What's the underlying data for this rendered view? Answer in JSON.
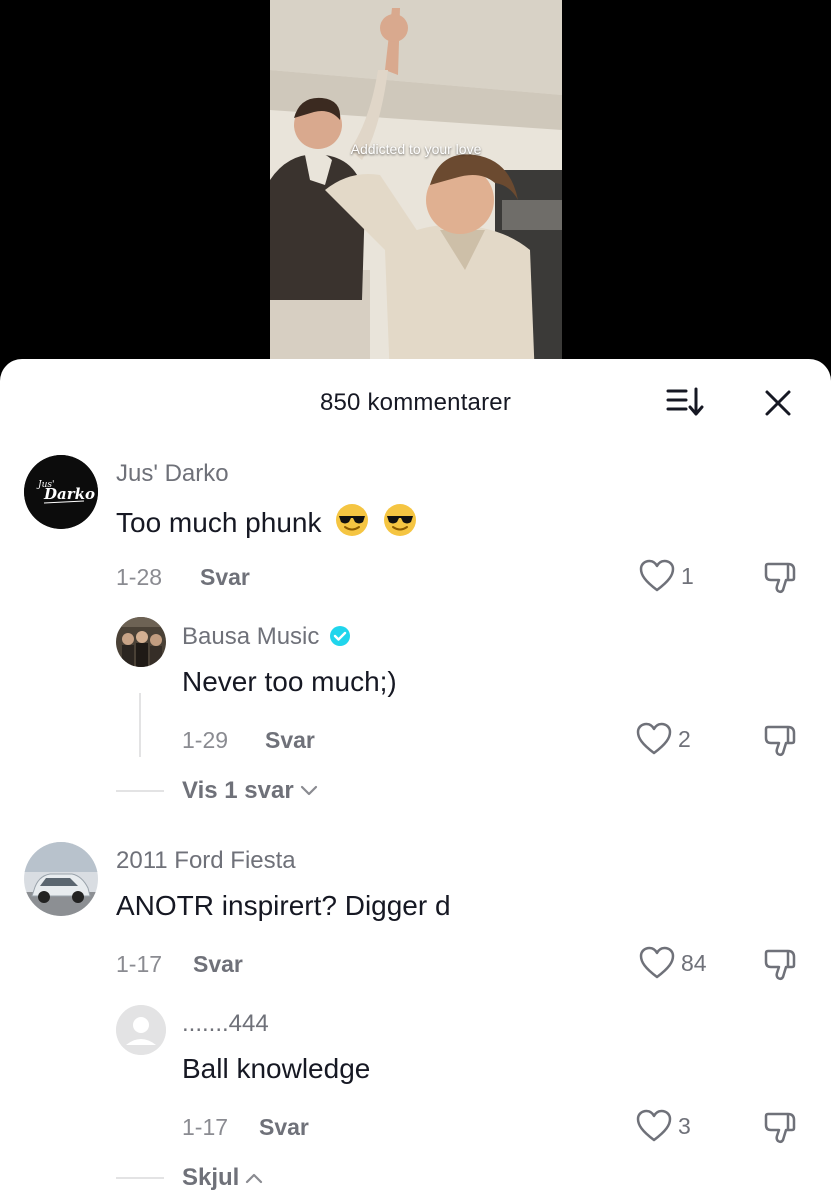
{
  "video": {
    "caption": "Addicted to your love"
  },
  "sheet": {
    "title": "850 kommentarer",
    "sort_icon": "sort-icon",
    "close_icon": "close-icon"
  },
  "comments": [
    {
      "username": "Jus' Darko",
      "avatar_text": "Jus' Darko",
      "text": "Too much phunk",
      "emoji_count": 2,
      "date": "1-28",
      "reply_label": "Svar",
      "likes": "1",
      "replies": [
        {
          "username": "Bausa Music",
          "verified": true,
          "text": "Never too much;)",
          "date": "1-29",
          "reply_label": "Svar",
          "likes": "2"
        }
      ],
      "more_label": "Vis 1 svar"
    },
    {
      "username": "2011 Ford Fiesta",
      "text": "ANOTR inspirert? Digger d",
      "date": "1-17",
      "reply_label": "Svar",
      "likes": "84",
      "replies": [
        {
          "username": ".......444",
          "verified": false,
          "text": "Ball knowledge",
          "date": "1-17",
          "reply_label": "Svar",
          "likes": "3"
        }
      ],
      "more_label": "Skjul"
    }
  ],
  "colors": {
    "verified": "#20d5ec",
    "text_primary": "#161823",
    "text_secondary": "#6f7179"
  }
}
